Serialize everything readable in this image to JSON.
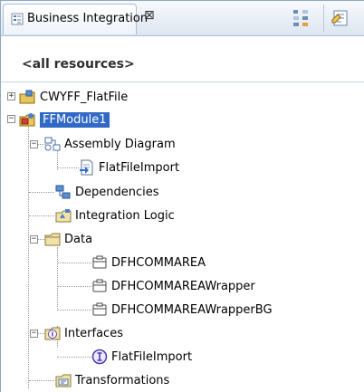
{
  "view": {
    "title": "Business Integration",
    "close_glyph": "⊠",
    "filter_label": "<all resources>"
  },
  "tree": {
    "project": "CWYFF_FlatFile",
    "module": "FFModule1",
    "assembly_diagram": "Assembly Diagram",
    "flatfile_import_component": "FlatFileImport",
    "dependencies": "Dependencies",
    "integration_logic": "Integration Logic",
    "data": "Data",
    "data_items": [
      "DFHCOMMAREA",
      "DFHCOMMAREAWrapper",
      "DFHCOMMAREAWrapperBG"
    ],
    "interfaces": "Interfaces",
    "interface_item": "FlatFileImport",
    "transformations": "Transformations"
  },
  "colors": {
    "selection": "#3169c6",
    "header_border": "#a9bdd6"
  }
}
